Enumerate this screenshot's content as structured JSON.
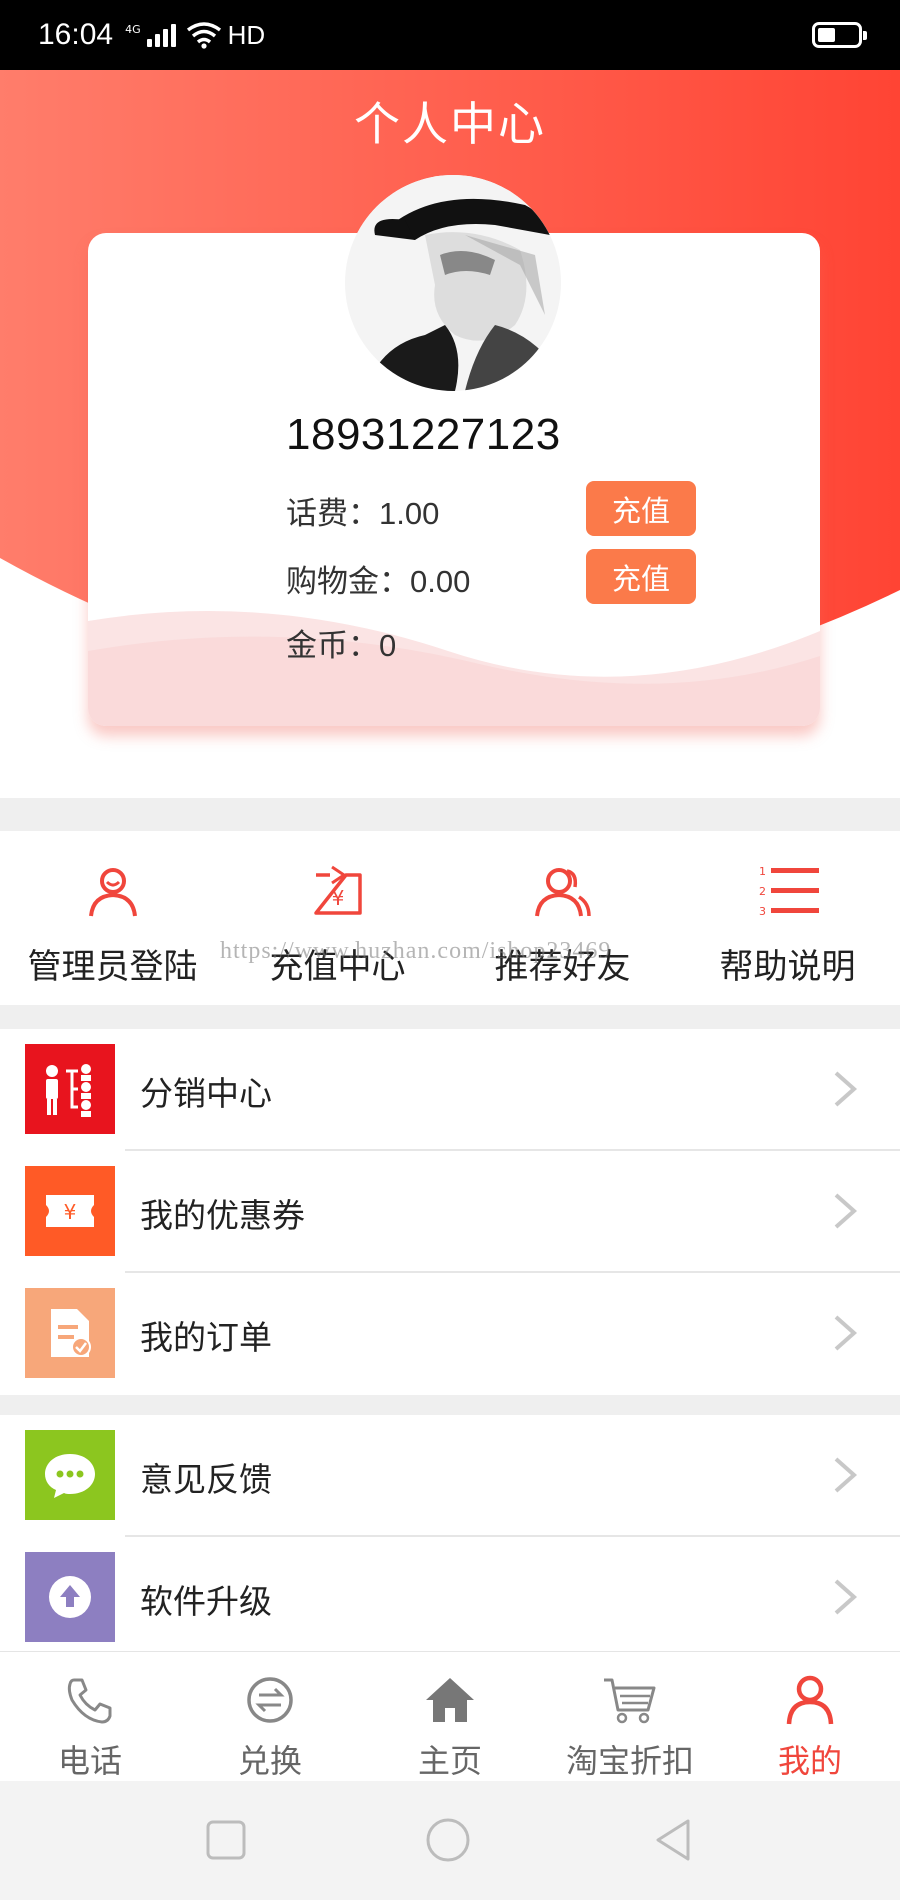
{
  "status_bar": {
    "time": "16:04",
    "network": "4G",
    "hd": "HD",
    "battery_level": 0.45
  },
  "header": {
    "title": "个人中心",
    "gradient_start": "#ff7d6b",
    "gradient_end": "#ff4434"
  },
  "profile": {
    "phone": "18931227123",
    "fee_label": "话费：",
    "fee_value": "1.00",
    "shopping_label": "购物金：",
    "shopping_value": "0.00",
    "coin_label": "金币：",
    "coin_value": "0",
    "recharge_fee_label": "充值",
    "recharge_shop_label": "充值"
  },
  "quick_actions": [
    {
      "label": "管理员登陆",
      "icon": "user-icon"
    },
    {
      "label": "充值中心",
      "icon": "recharge-icon"
    },
    {
      "label": "推荐好友",
      "icon": "friends-icon"
    },
    {
      "label": "帮助说明",
      "icon": "numbered-list-icon"
    }
  ],
  "watermark": "https://www.huzhan.com/ishop23469",
  "menu_group_1": [
    {
      "label": "分销中心",
      "icon": "distribution-icon",
      "color": "#e8141e"
    },
    {
      "label": "我的优惠券",
      "icon": "coupon-icon",
      "color": "#ff5a26"
    },
    {
      "label": "我的订单",
      "icon": "order-icon",
      "color": "#f7a77a"
    }
  ],
  "menu_group_2": [
    {
      "label": "意见反馈",
      "icon": "chat-icon",
      "color": "#8cc61f"
    },
    {
      "label": "软件升级",
      "icon": "upgrade-icon",
      "color": "#8d7fc1"
    }
  ],
  "bottom_nav": [
    {
      "label": "电话",
      "icon": "phone-icon"
    },
    {
      "label": "兑换",
      "icon": "exchange-icon"
    },
    {
      "label": "主页",
      "icon": "home-icon"
    },
    {
      "label": "淘宝折扣",
      "icon": "cart-icon"
    },
    {
      "label": "我的",
      "icon": "profile-icon",
      "active": true
    }
  ],
  "colors": {
    "accent": "#f0463c",
    "recharge_button": "#fb7a4a"
  }
}
